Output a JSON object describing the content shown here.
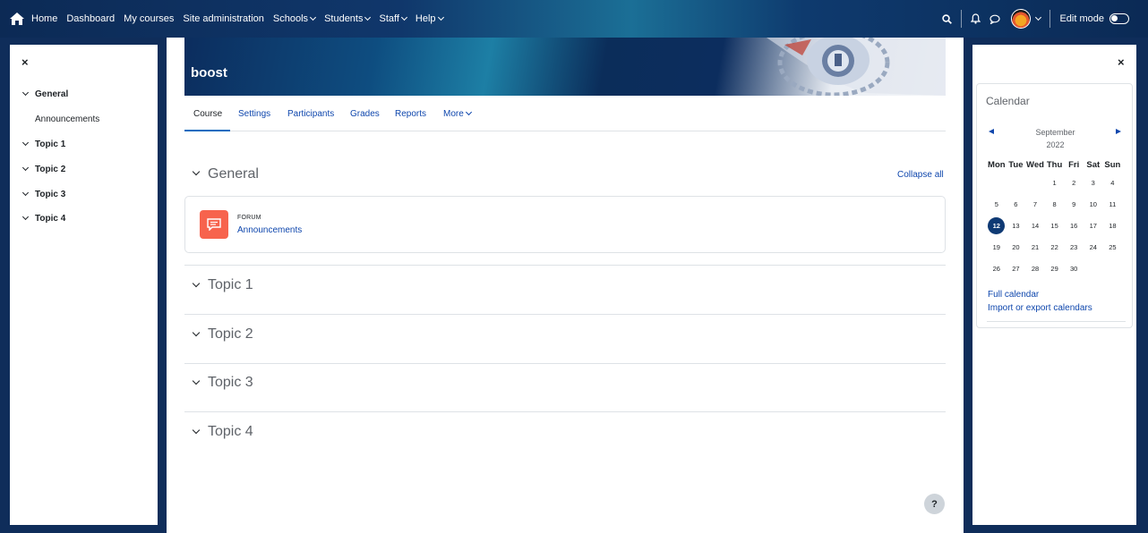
{
  "topnav": {
    "items": [
      {
        "label": "Home",
        "dropdown": false
      },
      {
        "label": "Dashboard",
        "dropdown": false
      },
      {
        "label": "My courses",
        "dropdown": false
      },
      {
        "label": "Site administration",
        "dropdown": false
      },
      {
        "label": "Schools",
        "dropdown": true
      },
      {
        "label": "Students",
        "dropdown": true
      },
      {
        "label": "Staff",
        "dropdown": true
      },
      {
        "label": "Help",
        "dropdown": true
      }
    ],
    "edit_mode_label": "Edit mode",
    "edit_mode_on": false
  },
  "course_index": {
    "close": "×",
    "items": [
      {
        "label": "General",
        "type": "section"
      },
      {
        "label": "Announcements",
        "type": "activity"
      },
      {
        "label": "Topic 1",
        "type": "section"
      },
      {
        "label": "Topic 2",
        "type": "section"
      },
      {
        "label": "Topic 3",
        "type": "section"
      },
      {
        "label": "Topic 4",
        "type": "section"
      }
    ]
  },
  "course": {
    "banner_title": "boost",
    "tabs": [
      "Course",
      "Settings",
      "Participants",
      "Grades",
      "Reports",
      "More"
    ],
    "active_tab": "Course",
    "collapse_all": "Collapse all",
    "sections": [
      "General",
      "Topic 1",
      "Topic 2",
      "Topic 3",
      "Topic 4"
    ],
    "activity": {
      "type": "FORUM",
      "name": "Announcements"
    },
    "help": "?"
  },
  "calendar": {
    "close": "×",
    "title": "Calendar",
    "month": "September",
    "year": "2022",
    "weekdays": [
      "Mon",
      "Tue",
      "Wed",
      "Thu",
      "Fri",
      "Sat",
      "Sun"
    ],
    "weeks": [
      [
        "",
        "",
        "",
        "1",
        "2",
        "3",
        "4"
      ],
      [
        "5",
        "6",
        "7",
        "8",
        "9",
        "10",
        "11"
      ],
      [
        "12",
        "13",
        "14",
        "15",
        "16",
        "17",
        "18"
      ],
      [
        "19",
        "20",
        "21",
        "22",
        "23",
        "24",
        "25"
      ],
      [
        "26",
        "27",
        "28",
        "29",
        "30",
        "",
        ""
      ]
    ],
    "today": "12",
    "links": [
      "Full calendar",
      "Import or export calendars"
    ]
  },
  "colors": {
    "nav": "#0c2a55",
    "link": "#0f47ad",
    "forum": "#f7634d",
    "today": "#0f3a74"
  }
}
